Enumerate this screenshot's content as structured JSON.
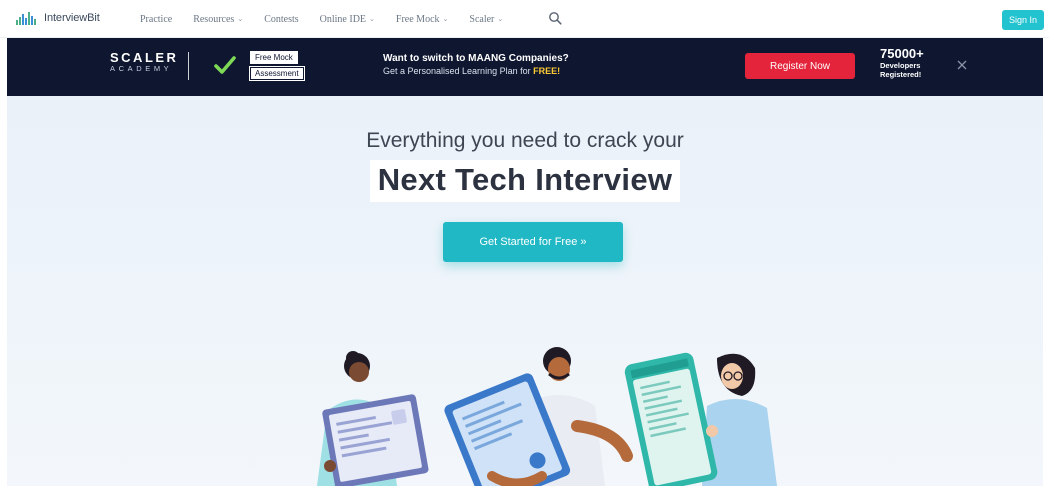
{
  "nav": {
    "logo_text": "InterviewBit",
    "items": [
      {
        "label": "Practice",
        "dropdown": false
      },
      {
        "label": "Resources",
        "dropdown": true
      },
      {
        "label": "Contests",
        "dropdown": false
      },
      {
        "label": "Online IDE",
        "dropdown": true
      },
      {
        "label": "Free Mock",
        "dropdown": true
      },
      {
        "label": "Scaler",
        "dropdown": true
      }
    ],
    "caret_glyph": "⌄",
    "search_icon": "search-icon",
    "signin_label": "Sign In"
  },
  "banner": {
    "brand_name": "SCALER",
    "brand_sub": "ACADEMY",
    "check_icon": "check-icon",
    "tag1": "Free Mock",
    "tag2": "Assessment",
    "title": "Want to switch to MAANG Companies?",
    "subtitle": "Get a Personalised Learning Plan for",
    "subtitle_highlight": "FREE!",
    "register_label": "Register Now",
    "dev_count": "75000+",
    "dev_label_1": "Developers",
    "dev_label_2": "Registered!",
    "close_icon": "close-icon"
  },
  "hero": {
    "subtitle": "Everything you need to crack your",
    "title": "Next Tech Interview",
    "cta_label": "Get Started for Free »"
  },
  "colors": {
    "brand_teal": "#1fb8c4",
    "banner_bg": "#0e1630",
    "register_red": "#e3243b",
    "highlight_yellow": "#ffcc33"
  }
}
